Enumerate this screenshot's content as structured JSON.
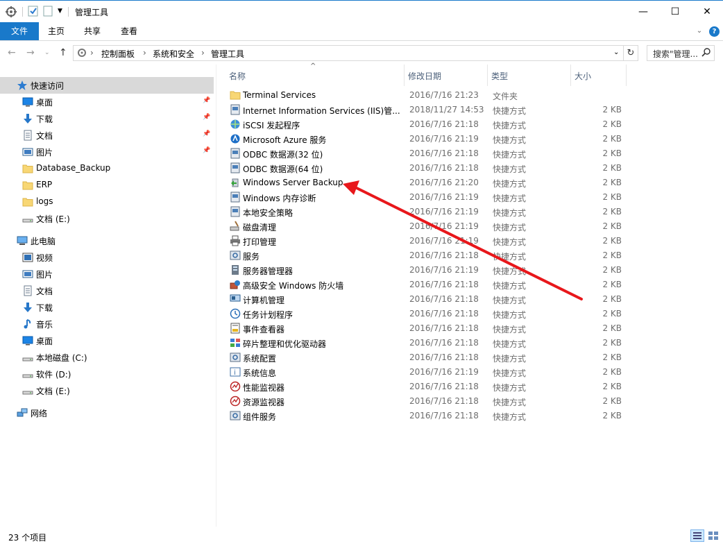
{
  "window": {
    "title": "管理工具",
    "minimize": "—",
    "maximize": "☐",
    "close": "✕"
  },
  "ribbon": {
    "tabs": [
      "文件",
      "主页",
      "共享",
      "查看"
    ],
    "help": "?"
  },
  "address": {
    "crumbs": [
      "控制面板",
      "系统和安全",
      "管理工具"
    ],
    "search_placeholder": "搜索\"管理..."
  },
  "nav": {
    "quick_access": "快速访问",
    "items": [
      {
        "label": "快速访问",
        "icon": "star-icon",
        "selected": true,
        "pinned": false
      },
      {
        "label": "桌面",
        "icon": "desktop-icon",
        "pinned": true
      },
      {
        "label": "下载",
        "icon": "download-icon",
        "pinned": true
      },
      {
        "label": "文档",
        "icon": "document-icon",
        "pinned": true
      },
      {
        "label": "图片",
        "icon": "picture-icon",
        "pinned": true
      },
      {
        "label": "Database_Backup",
        "icon": "folder-icon",
        "pinned": false
      },
      {
        "label": "ERP",
        "icon": "folder-icon",
        "pinned": false
      },
      {
        "label": "logs",
        "icon": "folder-icon",
        "pinned": false
      },
      {
        "label": "文档 (E:)",
        "icon": "drive-icon",
        "pinned": false
      },
      {
        "label": "此电脑",
        "icon": "computer-icon",
        "pinned": false
      },
      {
        "label": "视频",
        "icon": "video-icon",
        "pinned": false
      },
      {
        "label": "图片",
        "icon": "picture-icon",
        "pinned": false
      },
      {
        "label": "文档",
        "icon": "document-icon",
        "pinned": false
      },
      {
        "label": "下载",
        "icon": "download-icon",
        "pinned": false
      },
      {
        "label": "音乐",
        "icon": "music-icon",
        "pinned": false
      },
      {
        "label": "桌面",
        "icon": "desktop-icon",
        "pinned": false
      },
      {
        "label": "本地磁盘 (C:)",
        "icon": "drive-icon",
        "pinned": false
      },
      {
        "label": "软件 (D:)",
        "icon": "drive-icon",
        "pinned": false
      },
      {
        "label": "文档 (E:)",
        "icon": "drive-icon",
        "pinned": false
      },
      {
        "label": "网络",
        "icon": "network-icon",
        "pinned": false
      }
    ]
  },
  "columns": {
    "name": "名称",
    "date": "修改日期",
    "type": "类型",
    "size": "大小"
  },
  "files": [
    {
      "name": "Terminal Services",
      "date": "2016/7/16 21:23",
      "type": "文件夹",
      "size": "",
      "icon": "folder-icon"
    },
    {
      "name": "Internet Information Services (IIS)管...",
      "date": "2018/11/27 14:53",
      "type": "快捷方式",
      "size": "2 KB",
      "icon": "iis-icon"
    },
    {
      "name": "iSCSI 发起程序",
      "date": "2016/7/16 21:18",
      "type": "快捷方式",
      "size": "2 KB",
      "icon": "globe-icon"
    },
    {
      "name": "Microsoft Azure 服务",
      "date": "2016/7/16 21:19",
      "type": "快捷方式",
      "size": "2 KB",
      "icon": "azure-icon"
    },
    {
      "name": "ODBC 数据源(32 位)",
      "date": "2016/7/16 21:18",
      "type": "快捷方式",
      "size": "2 KB",
      "icon": "odbc-icon"
    },
    {
      "name": "ODBC 数据源(64 位)",
      "date": "2016/7/16 21:18",
      "type": "快捷方式",
      "size": "2 KB",
      "icon": "odbc-icon"
    },
    {
      "name": "Windows Server Backup",
      "date": "2016/7/16 21:20",
      "type": "快捷方式",
      "size": "2 KB",
      "icon": "backup-icon"
    },
    {
      "name": "Windows 内存诊断",
      "date": "2016/7/16 21:19",
      "type": "快捷方式",
      "size": "2 KB",
      "icon": "memory-icon"
    },
    {
      "name": "本地安全策略",
      "date": "2016/7/16 21:19",
      "type": "快捷方式",
      "size": "2 KB",
      "icon": "policy-icon"
    },
    {
      "name": "磁盘清理",
      "date": "2016/7/16 21:19",
      "type": "快捷方式",
      "size": "2 KB",
      "icon": "cleanup-icon"
    },
    {
      "name": "打印管理",
      "date": "2016/7/16 21:19",
      "type": "快捷方式",
      "size": "2 KB",
      "icon": "printer-icon"
    },
    {
      "name": "服务",
      "date": "2016/7/16 21:18",
      "type": "快捷方式",
      "size": "2 KB",
      "icon": "services-icon"
    },
    {
      "name": "服务器管理器",
      "date": "2016/7/16 21:19",
      "type": "快捷方式",
      "size": "2 KB",
      "icon": "server-icon"
    },
    {
      "name": "高级安全 Windows 防火墙",
      "date": "2016/7/16 21:18",
      "type": "快捷方式",
      "size": "2 KB",
      "icon": "firewall-icon"
    },
    {
      "name": "计算机管理",
      "date": "2016/7/16 21:18",
      "type": "快捷方式",
      "size": "2 KB",
      "icon": "computer-mgmt-icon"
    },
    {
      "name": "任务计划程序",
      "date": "2016/7/16 21:18",
      "type": "快捷方式",
      "size": "2 KB",
      "icon": "clock-icon"
    },
    {
      "name": "事件查看器",
      "date": "2016/7/16 21:18",
      "type": "快捷方式",
      "size": "2 KB",
      "icon": "event-icon"
    },
    {
      "name": "碎片整理和优化驱动器",
      "date": "2016/7/16 21:18",
      "type": "快捷方式",
      "size": "2 KB",
      "icon": "defrag-icon"
    },
    {
      "name": "系统配置",
      "date": "2016/7/16 21:18",
      "type": "快捷方式",
      "size": "2 KB",
      "icon": "config-icon"
    },
    {
      "name": "系统信息",
      "date": "2016/7/16 21:19",
      "type": "快捷方式",
      "size": "2 KB",
      "icon": "info-icon"
    },
    {
      "name": "性能监视器",
      "date": "2016/7/16 21:18",
      "type": "快捷方式",
      "size": "2 KB",
      "icon": "perf-icon"
    },
    {
      "name": "资源监视器",
      "date": "2016/7/16 21:18",
      "type": "快捷方式",
      "size": "2 KB",
      "icon": "resmon-icon"
    },
    {
      "name": "组件服务",
      "date": "2016/7/16 21:18",
      "type": "快捷方式",
      "size": "2 KB",
      "icon": "component-icon"
    }
  ],
  "status": {
    "count": "23 个项目"
  },
  "annotation": {
    "color": "#e8171b"
  }
}
